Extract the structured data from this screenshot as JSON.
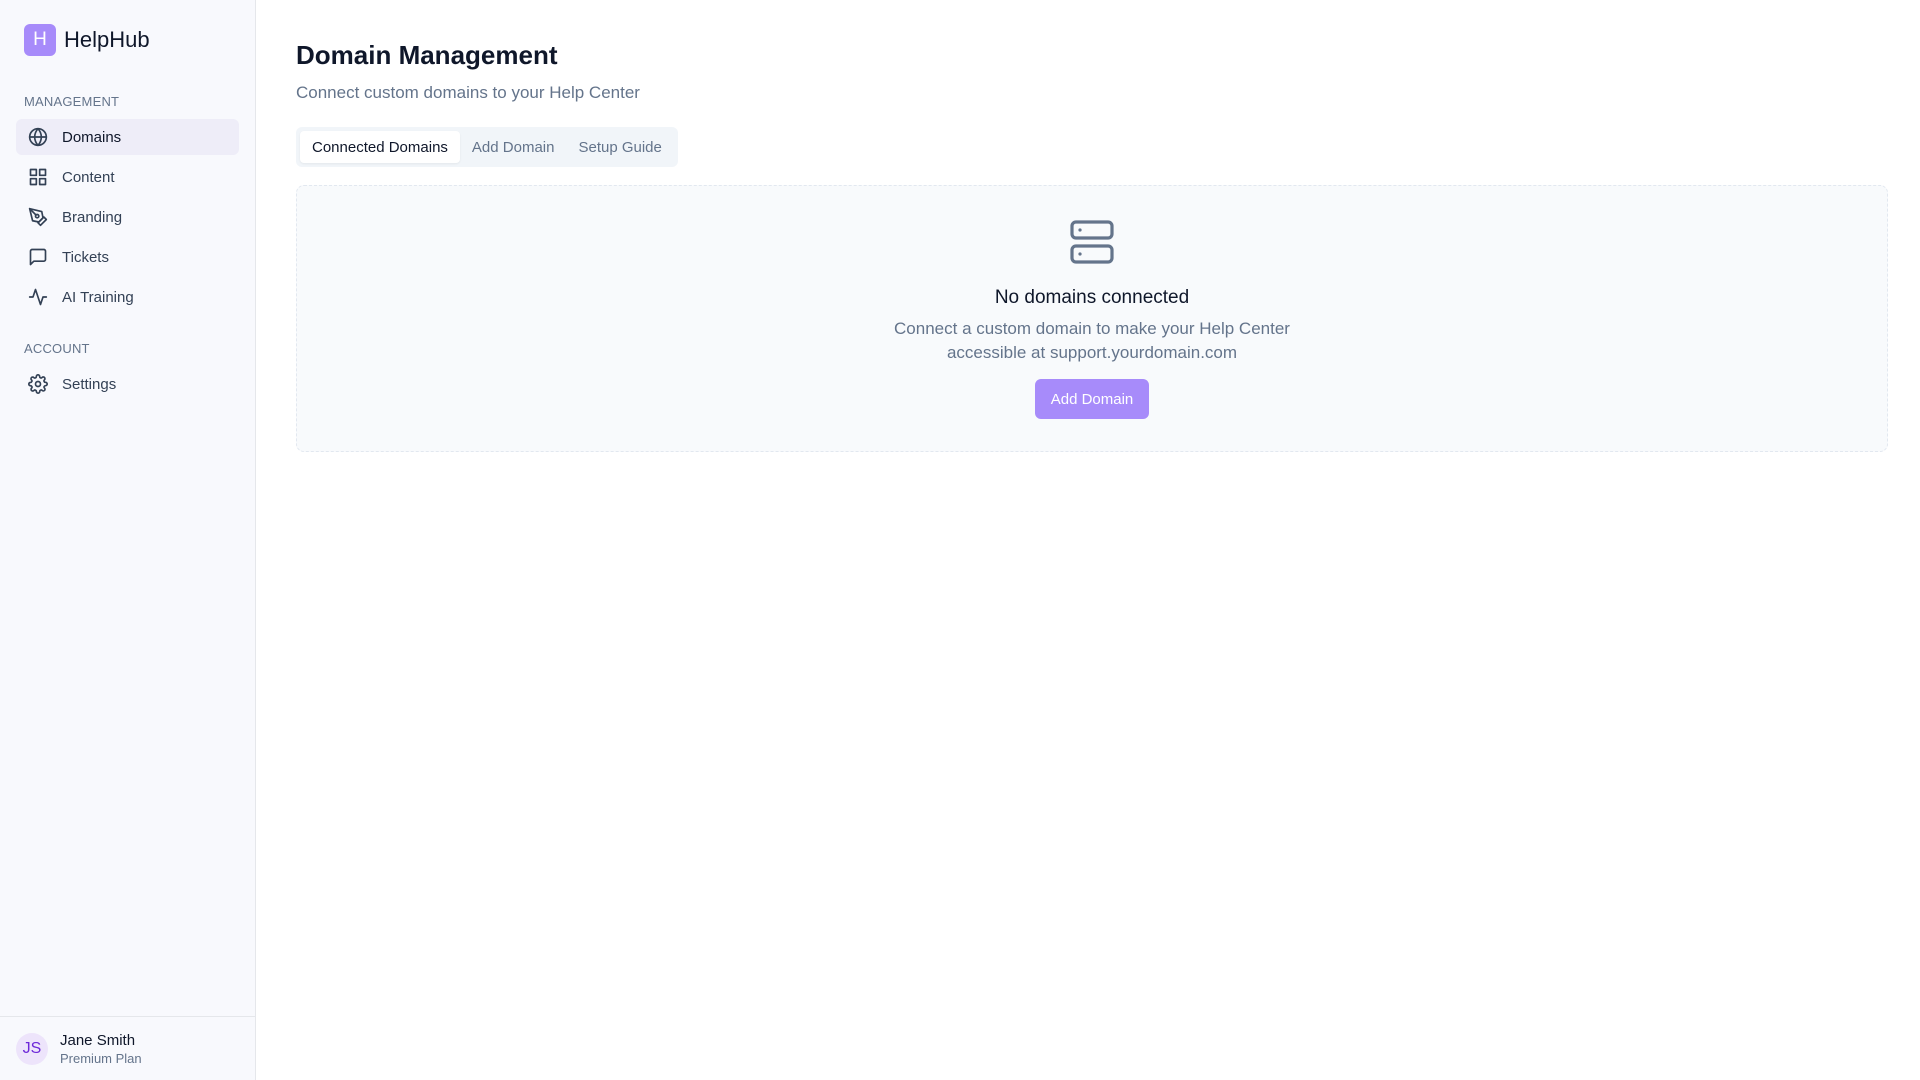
{
  "brand": {
    "logo_letter": "H",
    "name": "HelpHub",
    "accent": "#a78bfa"
  },
  "sidebar": {
    "sections": [
      {
        "label": "MANAGEMENT",
        "items": [
          {
            "label": "Domains",
            "icon": "globe-icon",
            "active": true
          },
          {
            "label": "Content",
            "icon": "grid-icon",
            "active": false
          },
          {
            "label": "Branding",
            "icon": "pen-tool-icon",
            "active": false
          },
          {
            "label": "Tickets",
            "icon": "message-square-icon",
            "active": false
          },
          {
            "label": "AI Training",
            "icon": "activity-icon",
            "active": false
          }
        ]
      },
      {
        "label": "ACCOUNT",
        "items": [
          {
            "label": "Settings",
            "icon": "gear-icon",
            "active": false
          }
        ]
      }
    ]
  },
  "user": {
    "initials": "JS",
    "name": "Jane Smith",
    "plan": "Premium Plan"
  },
  "main": {
    "title": "Domain Management",
    "subtitle": "Connect custom domains to your Help Center",
    "tabs": [
      {
        "label": "Connected Domains",
        "active": true
      },
      {
        "label": "Add Domain",
        "active": false
      },
      {
        "label": "Setup Guide",
        "active": false
      }
    ],
    "empty_state": {
      "icon": "server-icon",
      "title": "No domains connected",
      "description": "Connect a custom domain to make your Help Center accessible at support.yourdomain.com",
      "button_label": "Add Domain"
    }
  }
}
